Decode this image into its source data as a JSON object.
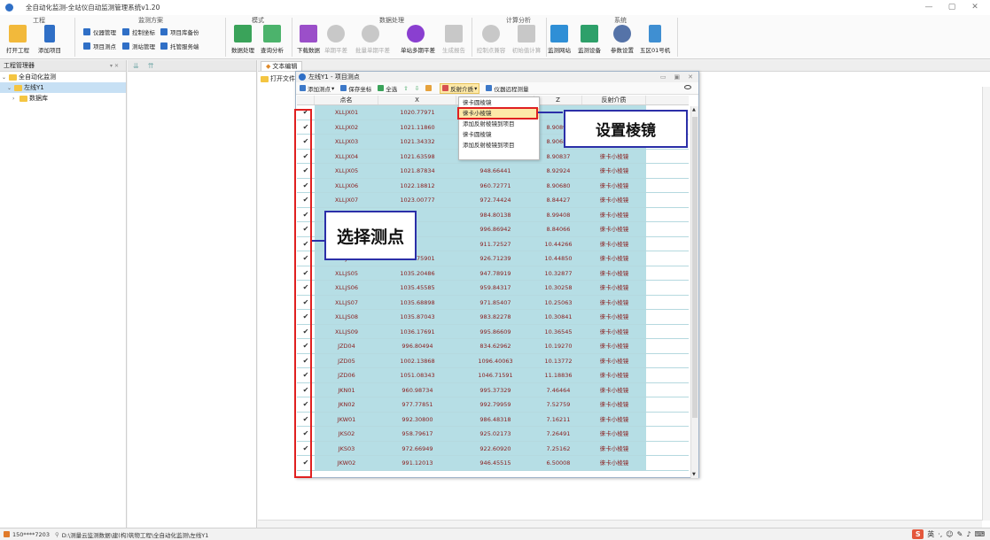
{
  "app": {
    "title": "全自动化监测-全站仪自动监测管理系统v1.20",
    "controls": [
      "—",
      "▢",
      "✕"
    ]
  },
  "ribbon": {
    "groups": [
      "工程",
      "监测方案",
      "模式",
      "数据处理",
      "计算分析",
      "系统"
    ],
    "project": {
      "open": "打开工程",
      "add": "添加项目"
    },
    "scheme_small": {
      "instrument": "仪器管理",
      "control_coord": "控制坐标",
      "project_backup": "项目库备份",
      "project_points": "项目测点",
      "survey_manage": "测站管理",
      "hosting": "托管服务端"
    },
    "mode": {
      "data_processing": "数据处理",
      "query": "查询分析"
    },
    "data": {
      "download": "下载数据",
      "single_adjust": "单期平差",
      "batch_adjust": "批量单期平差",
      "multi_adjust": "单站多期平差",
      "report": "生成报告"
    },
    "calc": {
      "control_check": "控制点兼容",
      "init_calc": "初始值计算"
    },
    "system": {
      "monitor_site": "监测网站",
      "device": "监测设备",
      "params": "参数设置",
      "machine": "五区01号机"
    }
  },
  "left_panel": {
    "title": "工程管理器",
    "tree": [
      "全自动化监测",
      "左线Y1",
      "数据库"
    ]
  },
  "work": {
    "tab1": "文本编辑",
    "tab2": "打开文件"
  },
  "window": {
    "title": "左线Y1 - 项目测点",
    "toolbar": {
      "add_point": "添加测点",
      "save_coord": "保存坐标",
      "select_all": "全选",
      "reflector": "反射介质",
      "distance": "仪器远程测量"
    },
    "columns": [
      "",
      "点名",
      "X",
      "Y",
      "Z",
      "反射介质"
    ],
    "rows": [
      [
        "✔",
        "XLLJX01",
        "1020.77971",
        "",
        "",
        ""
      ],
      [
        "✔",
        "XLLJX02",
        "1021.11860",
        "",
        "8.90898",
        ""
      ],
      [
        "✔",
        "XLLJX03",
        "1021.34332",
        "",
        "8.90684",
        ""
      ],
      [
        "✔",
        "XLLJX04",
        "1021.63598",
        "",
        "8.90837",
        "徕卡小棱镜"
      ],
      [
        "✔",
        "XLLJX05",
        "1021.87834",
        "948.66441",
        "8.92924",
        "徕卡小棱镜"
      ],
      [
        "✔",
        "XLLJX06",
        "1022.18812",
        "960.72771",
        "8.90680",
        "徕卡小棱镜"
      ],
      [
        "✔",
        "XLLJX07",
        "1023.00777",
        "972.74424",
        "8.84427",
        "徕卡小棱镜"
      ],
      [
        "✔",
        "",
        "",
        "984.80138",
        "8.99408",
        "徕卡小棱镜"
      ],
      [
        "✔",
        "",
        "",
        "996.86942",
        "8.84066",
        "徕卡小棱镜"
      ],
      [
        "✔",
        "",
        "",
        "911.72527",
        "10.44266",
        "徕卡小棱镜"
      ],
      [
        "✔",
        "XLLJS03",
        "1034.75901",
        "926.71239",
        "10.44850",
        "徕卡小棱镜"
      ],
      [
        "✔",
        "XLLJS05",
        "1035.20486",
        "947.78919",
        "10.32877",
        "徕卡小棱镜"
      ],
      [
        "✔",
        "XLLJS06",
        "1035.45585",
        "959.84317",
        "10.30258",
        "徕卡小棱镜"
      ],
      [
        "✔",
        "XLLJS07",
        "1035.68898",
        "971.85407",
        "10.25063",
        "徕卡小棱镜"
      ],
      [
        "✔",
        "XLLJS08",
        "1035.87043",
        "983.82278",
        "10.30841",
        "徕卡小棱镜"
      ],
      [
        "✔",
        "XLLJS09",
        "1036.17691",
        "995.86609",
        "10.36545",
        "徕卡小棱镜"
      ],
      [
        "✔",
        "JZD04",
        "996.80494",
        "834.62962",
        "10.19270",
        "徕卡小棱镜"
      ],
      [
        "✔",
        "JZD05",
        "1002.13868",
        "1096.40063",
        "10.13772",
        "徕卡小棱镜"
      ],
      [
        "✔",
        "JZD06",
        "1051.08343",
        "1046.71591",
        "11.18836",
        "徕卡小棱镜"
      ],
      [
        "✔",
        "JKN01",
        "960.98734",
        "995.37329",
        "7.46464",
        "徕卡小棱镜"
      ],
      [
        "✔",
        "JKN02",
        "977.77851",
        "992.79959",
        "7.52759",
        "徕卡小棱镜"
      ],
      [
        "✔",
        "JKW01",
        "992.30800",
        "986.48318",
        "7.16211",
        "徕卡小棱镜"
      ],
      [
        "✔",
        "JKS02",
        "958.79617",
        "925.02173",
        "7.26491",
        "徕卡小棱镜"
      ],
      [
        "✔",
        "JKS03",
        "972.66949",
        "922.60920",
        "7.25162",
        "徕卡小棱镜"
      ],
      [
        "✔",
        "JKW02",
        "991.12013",
        "946.45515",
        "6.50008",
        "徕卡小棱镜"
      ]
    ]
  },
  "dropdown": {
    "items": [
      "徕卡圆棱镜",
      "徕卡小棱镜",
      "添加反射棱镜到项目",
      "徕卡圆棱镜",
      "添加反射棱镜到项目"
    ]
  },
  "annotations": {
    "set_prism": "设置棱镜",
    "select_points": "选择测点"
  },
  "status": {
    "user": "150****7203",
    "path": "D:\\测量云监测数据\\建(构)筑物工程\\全自动化监测\\左线Y1",
    "ime": "英"
  }
}
